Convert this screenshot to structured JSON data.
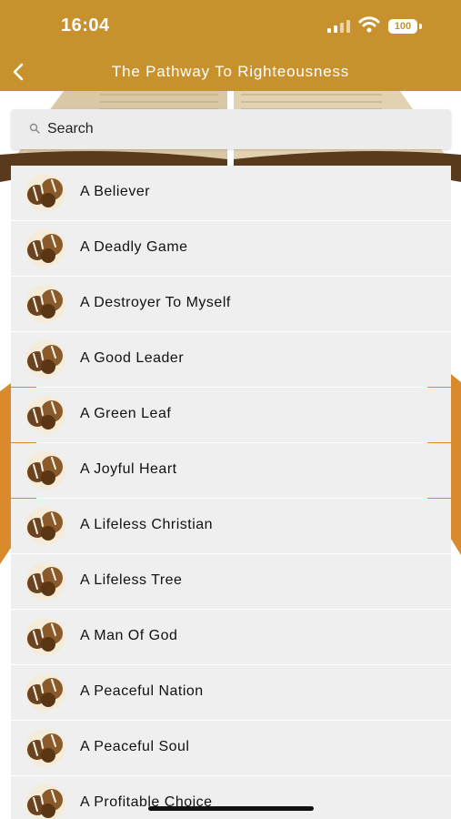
{
  "status_bar": {
    "time": "16:04",
    "battery": "100"
  },
  "nav": {
    "title": "The Pathway To Righteousness",
    "back_icon": "chevron-left-icon"
  },
  "search": {
    "placeholder": "Search",
    "value": ""
  },
  "colors": {
    "brand": "#c7912e",
    "list_bg": "#efefef"
  },
  "items": [
    {
      "label": "A Believer"
    },
    {
      "label": "A Deadly Game"
    },
    {
      "label": "A Destroyer To Myself"
    },
    {
      "label": "A Good Leader"
    },
    {
      "label": "A Green Leaf"
    },
    {
      "label": "A Joyful Heart"
    },
    {
      "label": "A Lifeless Christian"
    },
    {
      "label": "A Lifeless Tree"
    },
    {
      "label": "A Man Of God"
    },
    {
      "label": "A Peaceful Nation"
    },
    {
      "label": "A Peaceful Soul"
    },
    {
      "label": "A Profitable Choice"
    }
  ]
}
